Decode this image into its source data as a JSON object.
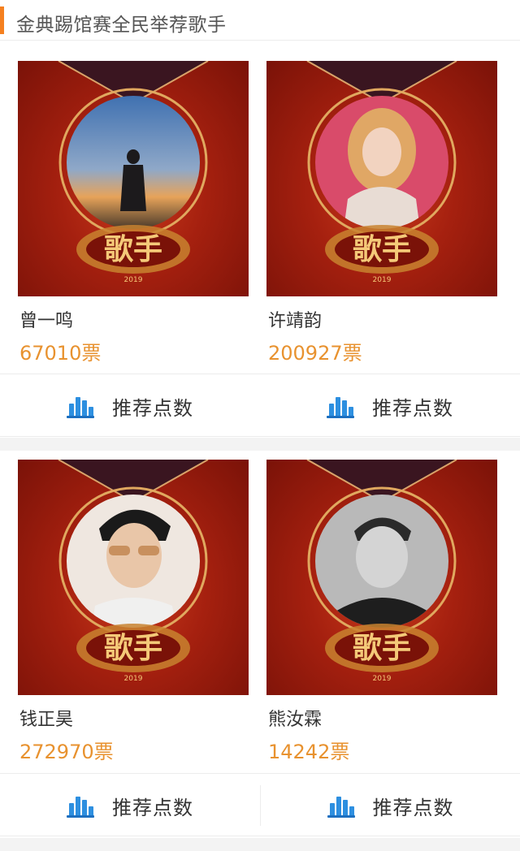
{
  "header": {
    "title": "金典踢馆赛全民举荐歌手"
  },
  "colors": {
    "accent": "#f5801f",
    "votes": "#e8922f",
    "icon": "#2d8fe0",
    "poster": "#a5200f"
  },
  "singers": [
    {
      "name": "曾一鸣",
      "votes": "67010票",
      "photo": "sunset-silhouette"
    },
    {
      "name": "许靖韵",
      "votes": "200927票",
      "photo": "pink-portrait"
    },
    {
      "name": "钱正昊",
      "votes": "272970票",
      "photo": "sunglasses-portrait"
    },
    {
      "name": "熊汝霖",
      "votes": "14242票",
      "photo": "grayscale-portrait"
    }
  ],
  "poster_logo": {
    "text": "歌手",
    "year": "2019"
  },
  "buttons": {
    "recommend_label": "推荐点数",
    "icon": "bar-chart-icon"
  }
}
